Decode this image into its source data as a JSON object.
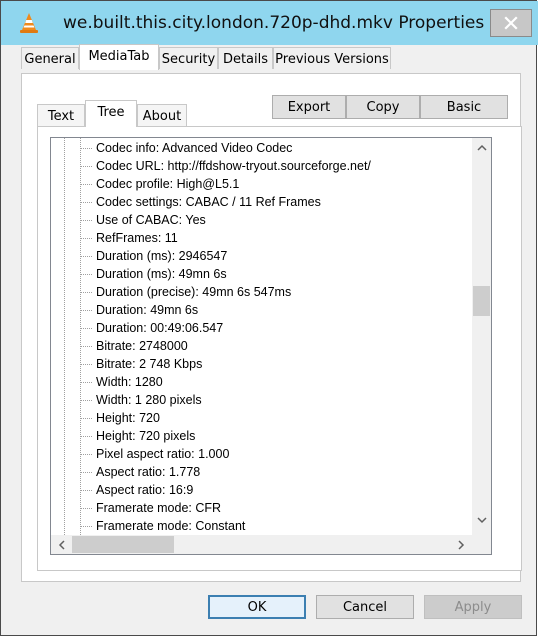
{
  "window": {
    "title": "we.built.this.city.london.720p-dhd.mkv Properties"
  },
  "tabs": [
    {
      "label": "General"
    },
    {
      "label": "MediaTab"
    },
    {
      "label": "Security"
    },
    {
      "label": "Details"
    },
    {
      "label": "Previous Versions"
    }
  ],
  "inner_tabs": [
    {
      "label": "Text"
    },
    {
      "label": "Tree"
    },
    {
      "label": "About"
    }
  ],
  "toolbar": {
    "export_label": "Export",
    "copy_label": "Copy",
    "basic_label": "Basic"
  },
  "tree_rows": [
    "Codec info: Advanced Video Codec",
    "Codec URL: http://ffdshow-tryout.sourceforge.net/",
    "Codec profile: High@L5.1",
    "Codec settings: CABAC / 11 Ref Frames",
    "Use of CABAC: Yes",
    "RefFrames: 11",
    "Duration (ms): 2946547",
    "Duration (ms): 49mn 6s",
    "Duration (precise): 49mn 6s 547ms",
    "Duration: 49mn 6s",
    "Duration: 00:49:06.547",
    "Bitrate: 2748000",
    "Bitrate: 2 748 Kbps",
    "Width: 1280",
    "Width: 1 280 pixels",
    "Height: 720",
    "Height: 720 pixels",
    "Pixel aspect ratio: 1.000",
    "Aspect ratio: 1.778",
    "Aspect ratio: 16:9",
    "Framerate mode: CFR",
    "Framerate mode: Constant"
  ],
  "footer": {
    "ok_label": "OK",
    "cancel_label": "Cancel",
    "apply_label": "Apply"
  },
  "colors": {
    "titlebar": "#8fd6ee",
    "button_focus_border": "#3c7fb1"
  },
  "icons": {
    "app": "vlc-cone-icon",
    "close": "close-icon"
  }
}
